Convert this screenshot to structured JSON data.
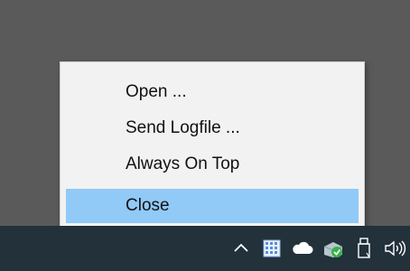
{
  "context_menu": {
    "items": [
      {
        "label": "Open ..."
      },
      {
        "label": "Send Logfile ..."
      },
      {
        "label": "Always On Top"
      },
      {
        "label": "Close",
        "highlighted": true
      }
    ],
    "highlight_color": "#91c9f7"
  },
  "taskbar": {
    "background": "#22313a",
    "tray_icons": [
      "chevron-up-icon",
      "app-grid-icon",
      "cloud-icon",
      "sync-check-icon",
      "usb-drive-icon",
      "volume-icon"
    ]
  }
}
